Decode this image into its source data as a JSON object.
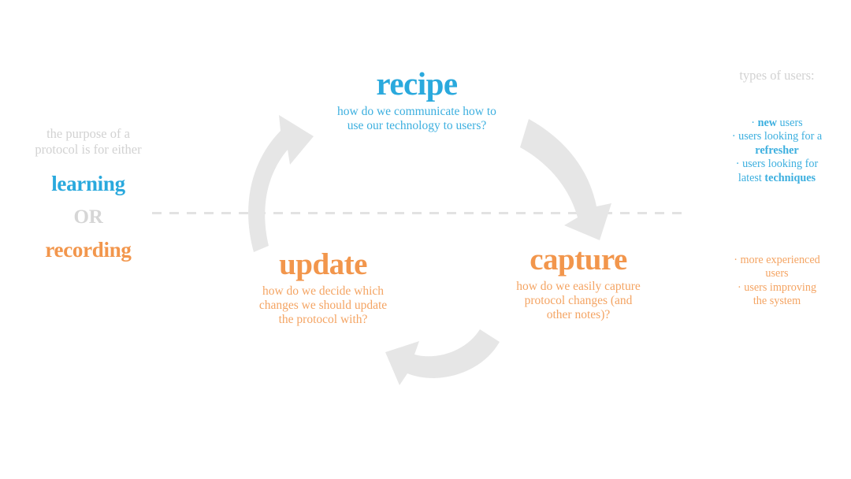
{
  "colors": {
    "blue": "#2aa9dd",
    "blue_text": "#3cafdf",
    "orange": "#f2964c",
    "orange_text": "#f4a463",
    "gray_light": "#d2d2d2",
    "arrow_gray": "#e6e6e6",
    "background": "#ffffff"
  },
  "purpose": {
    "lead_line1": "the purpose of a",
    "lead_line2": "protocol is for either",
    "option_learning": "learning",
    "option_or": "OR",
    "option_recording": "recording"
  },
  "cycle": {
    "nodes": [
      {
        "id": "recipe",
        "title": "recipe",
        "desc_line1": "how do we communicate how to",
        "desc_line2": "use our technology to users?",
        "color": "#2aa9dd"
      },
      {
        "id": "capture",
        "title": "capture",
        "desc_line1": "how do we easily capture",
        "desc_line2": "protocol changes (and",
        "desc_line3": "other notes)?",
        "color": "#f2964c"
      },
      {
        "id": "update",
        "title": "update",
        "desc_line1": "how do we decide which",
        "desc_line2": "changes we should update",
        "desc_line3": "the protocol with?",
        "color": "#f2964c"
      }
    ],
    "arrows": [
      {
        "name": "arrow-update-to-recipe",
        "direction": "up"
      },
      {
        "name": "arrow-recipe-to-capture",
        "direction": "down-right"
      },
      {
        "name": "arrow-capture-to-update",
        "direction": "left"
      }
    ]
  },
  "users_panel": {
    "title": "types of users:",
    "learning_users": [
      {
        "prefix": "· ",
        "bold1": "new",
        "plain1": " users"
      },
      {
        "prefix": "· ",
        "plain1": "users looking for a"
      },
      {
        "bold1": "refresher"
      },
      {
        "prefix": "· ",
        "plain1": "users looking for"
      },
      {
        "plain1": "latest ",
        "bold1": "techniques"
      }
    ],
    "recording_users": [
      {
        "prefix": "· ",
        "plain1": "more experienced"
      },
      {
        "plain1": "users"
      },
      {
        "prefix": "· ",
        "plain1": "users improving"
      },
      {
        "plain1": "the system"
      }
    ]
  }
}
